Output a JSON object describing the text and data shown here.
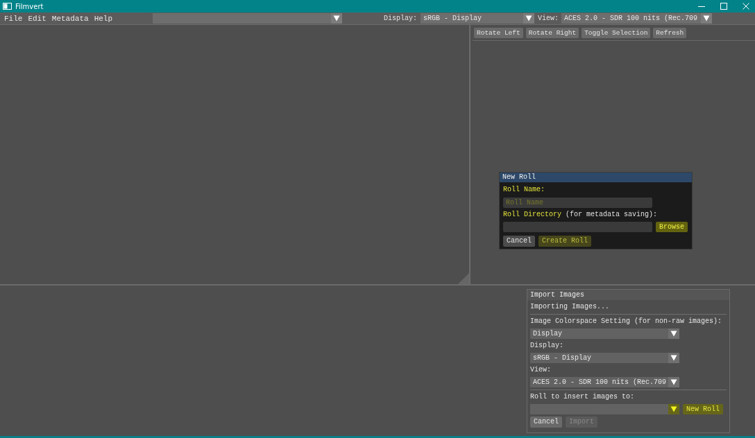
{
  "window": {
    "title": "Filmvert"
  },
  "menu_bar": {
    "menus": [
      "File",
      "Edit",
      "Metadata",
      "Help"
    ],
    "display": {
      "label": "Display:",
      "value": "sRGB - Display"
    },
    "view": {
      "label": "View:",
      "value": "ACES 2.0 - SDR 100 nits (Rec.709"
    }
  },
  "toolbar": {
    "buttons": [
      "Rotate Left",
      "Rotate Right",
      "Toggle Selection",
      "Refresh"
    ]
  },
  "new_roll_dialog": {
    "title": "New Roll",
    "name_field": {
      "label": "Roll Name:",
      "placeholder": "Roll Name",
      "highlighted": true
    },
    "directory_field": {
      "label": "Roll Directory",
      "note": "(for metadata saving):",
      "highlighted": true,
      "button": {
        "label": "Browse",
        "highlighted": true
      }
    },
    "buttons": [
      {
        "label": "Cancel",
        "highlighted": false
      },
      {
        "label": "Create Roll",
        "highlighted": true
      }
    ]
  },
  "import_panel": {
    "title": "Import Images",
    "status": "Importing Images...",
    "settings": [
      {
        "label": "Image Colorspace Setting (for non-raw images):",
        "value": "Display"
      },
      {
        "label": "Display:",
        "value": "sRGB - Display"
      },
      {
        "label": "View:",
        "value": "ACES 2.0 - SDR 100 nits (Rec.709"
      }
    ],
    "roll": {
      "label": "Roll to insert images to:",
      "highlighted": true,
      "button": {
        "label": "New Roll",
        "highlighted": true
      }
    },
    "buttons": [
      {
        "label": "Cancel",
        "disabled": false
      },
      {
        "label": "Import",
        "disabled": true
      }
    ]
  }
}
